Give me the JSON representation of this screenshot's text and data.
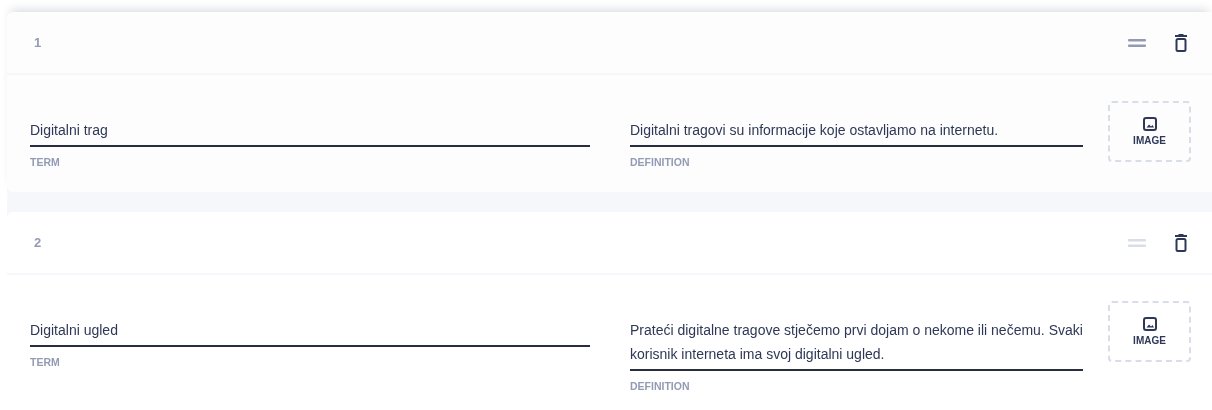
{
  "cards": [
    {
      "number": "1",
      "hovered": true,
      "term": {
        "value": "Digitalni trag",
        "label": "TERM"
      },
      "definition": {
        "value": "Digitalni tragovi su informacije koje ostavljamo na internetu.",
        "label": "DEFINITION"
      },
      "image_button": "IMAGE"
    },
    {
      "number": "2",
      "hovered": false,
      "term": {
        "value": "Digitalni ugled",
        "label": "TERM"
      },
      "definition": {
        "value": "Prateći digitalne tragove stječemo prvi dojam o nekome ili nečemu. Svaki korisnik interneta ima svoj digitalni ugled.",
        "label": "DEFINITION"
      },
      "image_button": "IMAGE"
    }
  ]
}
